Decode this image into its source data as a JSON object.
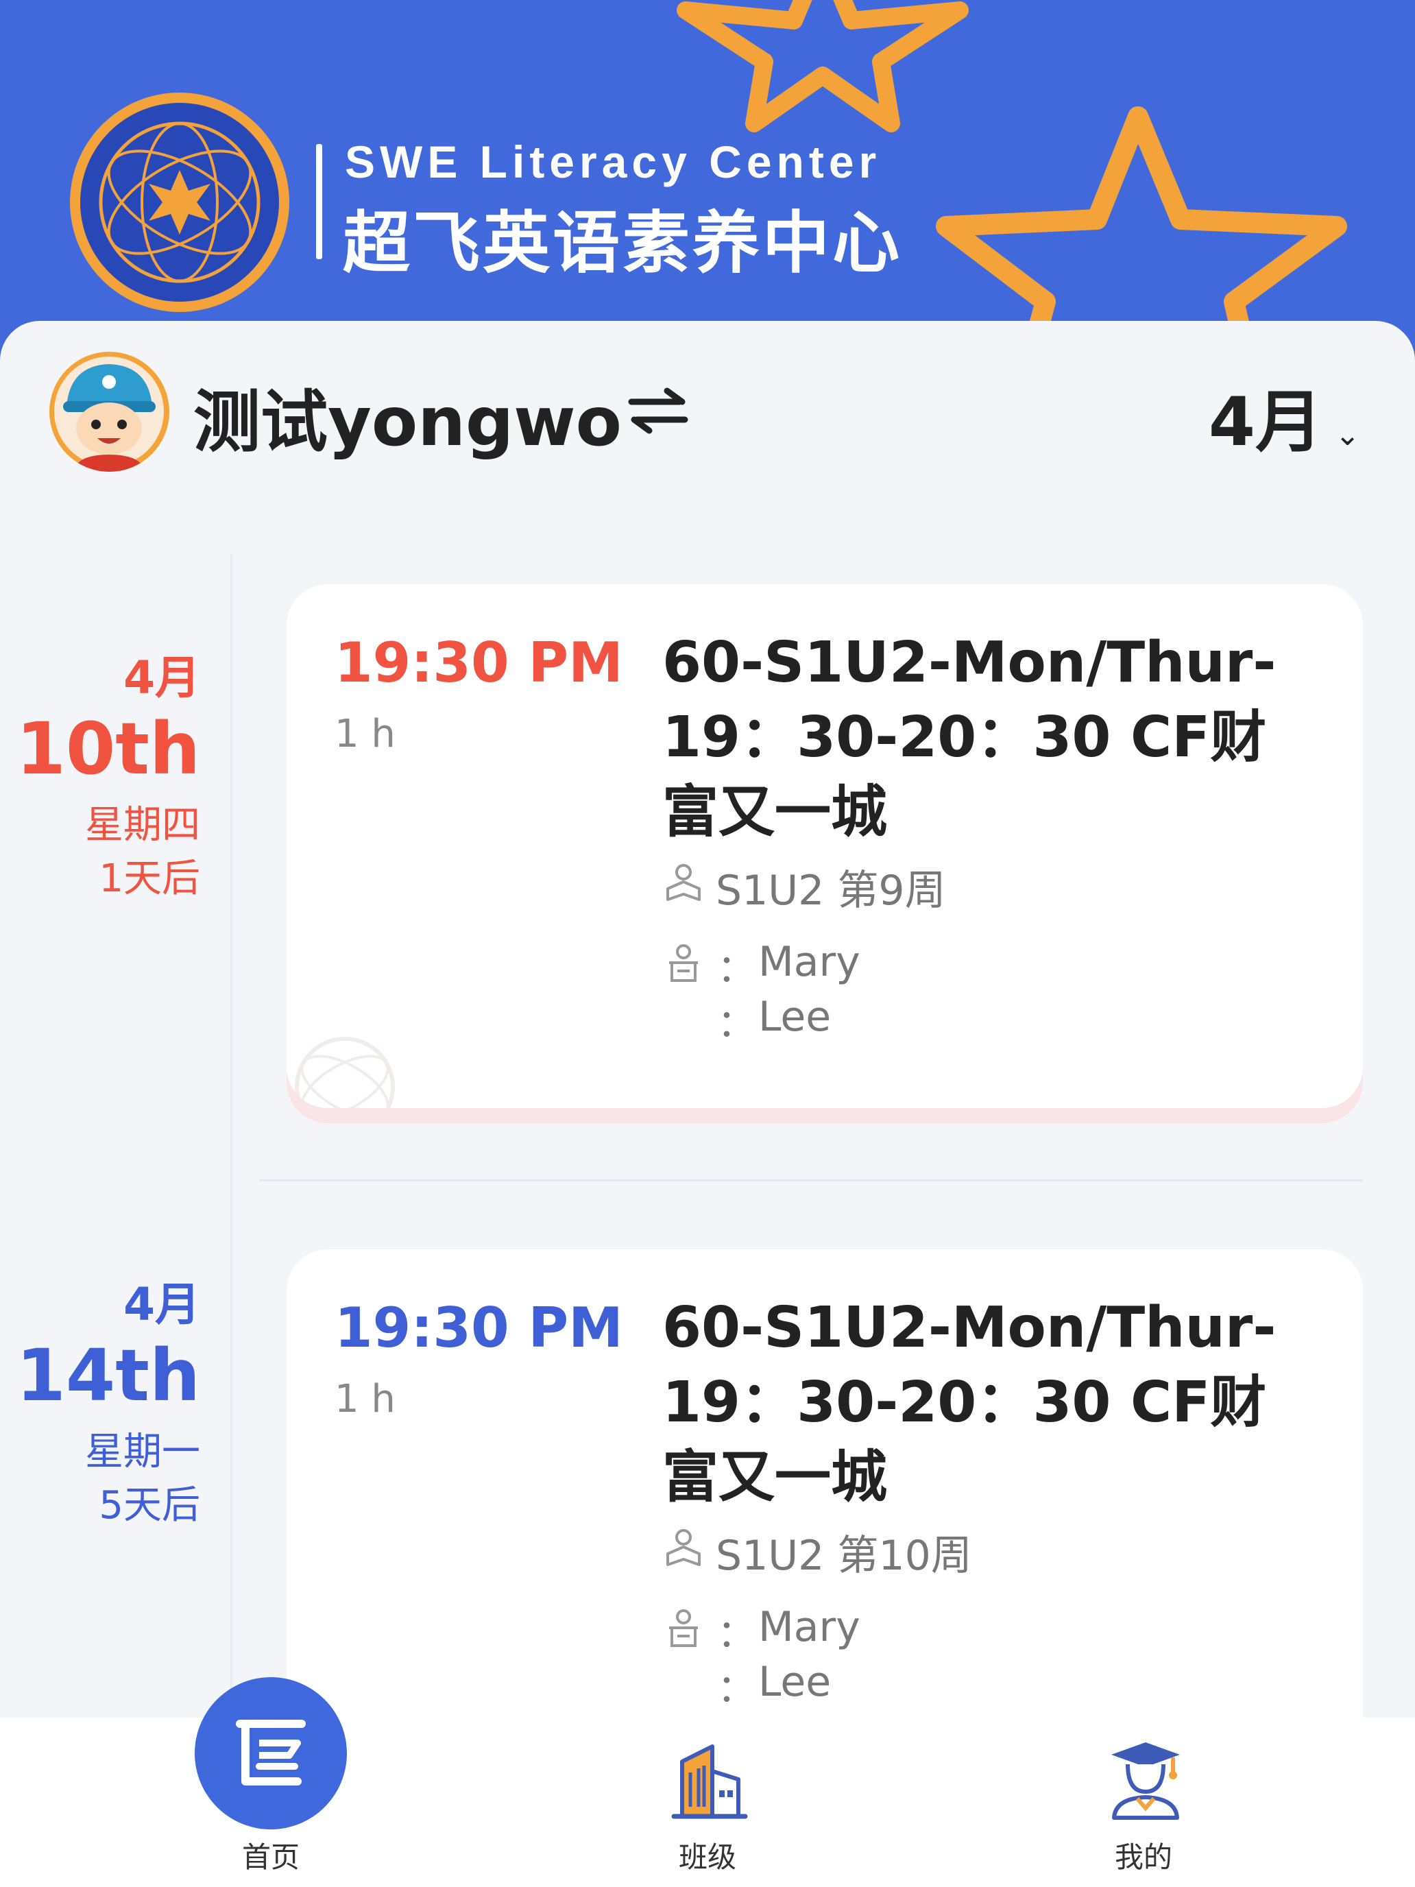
{
  "brand": {
    "name_en": "SWE Literacy Center",
    "name_cn": "超飞英语素养中心"
  },
  "user": {
    "name": "测试yongwo"
  },
  "month_selector": {
    "label": "4月"
  },
  "lessons": [
    {
      "date_month": "4月",
      "date_day": "10th",
      "weekday": "星期四",
      "relative": "1天后",
      "time": "19:30 PM",
      "duration": "1 h",
      "title": "60-S1U2-Mon/Thur-19：30-20：30 CF财富又一城",
      "week_info": "S1U2 第9周",
      "teachers": [
        "Mary",
        "Lee"
      ],
      "accent": "#F05340"
    },
    {
      "date_month": "4月",
      "date_day": "14th",
      "weekday": "星期一",
      "relative": "5天后",
      "time": "19:30 PM",
      "duration": "1 h",
      "title": "60-S1U2-Mon/Thur-19：30-20：30 CF财富又一城",
      "week_info": "S1U2 第10周",
      "teachers": [
        "Mary",
        "Lee"
      ],
      "accent": "#3F5FD6"
    }
  ],
  "teacher_separator": "：",
  "nav": {
    "home": "首页",
    "class": "班级",
    "mine": "我的"
  },
  "colors": {
    "header_bg": "#4169DB",
    "accent_orange": "#F3A33A",
    "upcoming_red": "#F05340",
    "later_blue": "#3F5FD6"
  },
  "icons": [
    "switch-icon",
    "chevron-down-icon",
    "book-user-icon",
    "teacher-icon",
    "home-icon",
    "class-icon",
    "mine-icon"
  ]
}
